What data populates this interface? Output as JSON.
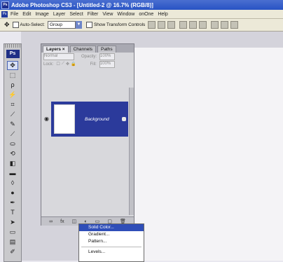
{
  "app": {
    "title": "Adobe Photoshop CS3 - [Untitled-2 @ 16.7% (RGB/8)]"
  },
  "menubar": {
    "items": [
      "File",
      "Edit",
      "Image",
      "Layer",
      "Select",
      "Filter",
      "View",
      "Window",
      "onOne",
      "Help"
    ]
  },
  "options": {
    "auto_select_label": "Auto-Select:",
    "auto_select_value": "Group",
    "show_transform_label": "Show Transform Controls"
  },
  "tools": {
    "logo": "Ps"
  },
  "layers_panel": {
    "tabs": [
      "Layers ×",
      "Channels",
      "Paths"
    ],
    "blend_mode": "Normal",
    "opacity_label": "Opacity:",
    "opacity_value": "100%",
    "lock_label": "Lock:",
    "fill_label": "Fill:",
    "fill_value": "100%",
    "layer_name": "Background"
  },
  "adjustment_menu": {
    "items": [
      "Solid Color...",
      "Gradient...",
      "Pattern...",
      "Levels..."
    ],
    "highlighted_index": 0
  },
  "colors": {
    "title_bar": "#2853c4",
    "selection": "#2b3a9b",
    "menu_highlight": "#2f4eb8"
  }
}
